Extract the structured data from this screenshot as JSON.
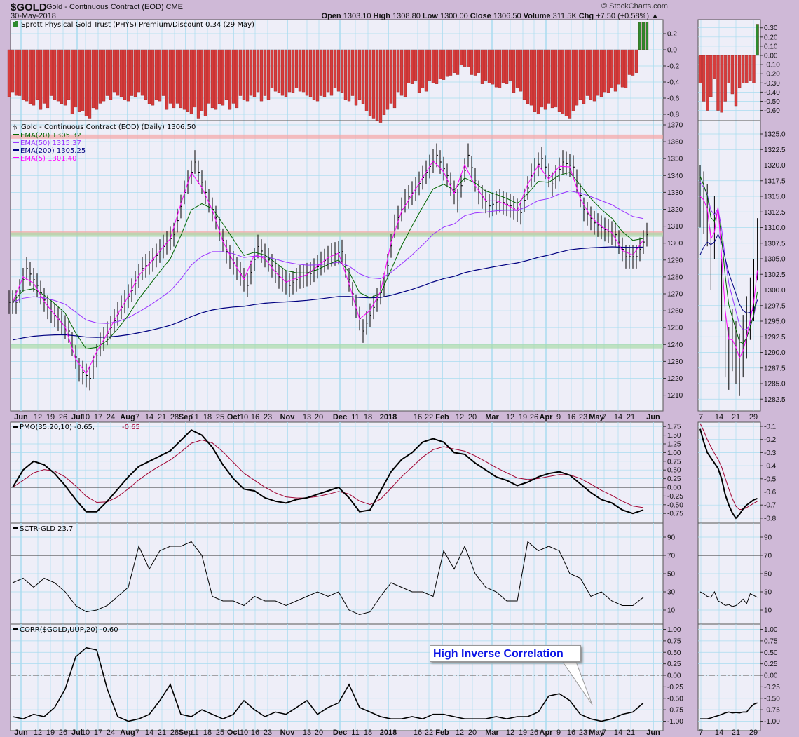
{
  "header": {
    "symbol": "$GOLD",
    "description": "Gold - Continuous Contract (EOD)",
    "exchange": "CME",
    "date": "30-May-2018",
    "copyright": "© StockCharts.com",
    "open_label": "Open",
    "open": "1303.10",
    "high_label": "High",
    "high": "1308.80",
    "low_label": "Low",
    "low": "1300.00",
    "close_label": "Close",
    "close": "1306.50",
    "volume_label": "Volume",
    "volume": "311.5K",
    "chg_label": "Chg",
    "chg": "+7.50 (+0.58%)"
  },
  "legends": {
    "phys": "Sprott Physical Gold Trust (PHYS) Premium/Discount 0.34 (29 May)",
    "price": "Gold - Continuous Contract (EOD) (Daily) 1306.50",
    "ema20": "EMA(20) 1305.32",
    "ema50": "EMA(50) 1315.37",
    "ema200": "EMA(200) 1305.25",
    "ema5": "EMA(5) 1301.40",
    "pmo": "PMO(35,20,10) -0.65,",
    "pmo_signal": "-0.65",
    "sctr": "SCTR-GLD 23.7",
    "corr": "CORR($GOLD,UUP,20) -0.60"
  },
  "annotation": "High Inverse Correlation",
  "colors": {
    "ema20": "#006600",
    "ema50": "#9933ff",
    "ema200": "#000080",
    "ema5": "#ff00ff",
    "pmo_signal": "#a00030",
    "bar_neg": "#d63c3c",
    "bar_pos": "#2e8b2e",
    "grid": "#a9dcef",
    "plot_bg": "#eeeef8",
    "frame_bg": "#cfb9d7"
  },
  "x_axis": {
    "main": [
      "Jun",
      "12",
      "19",
      "26",
      "Jul",
      "10",
      "17",
      "24",
      "Aug",
      "7",
      "14",
      "21",
      "28",
      "Sep",
      "11",
      "18",
      "25",
      "Oct",
      "10",
      "16",
      "23",
      "Nov",
      "13",
      "20",
      "Dec",
      "11",
      "18",
      "2018",
      "16",
      "22",
      "Feb",
      "12",
      "20",
      "Mar",
      "12",
      "19",
      "26",
      "Apr",
      "9",
      "16",
      "23",
      "May",
      "7",
      "14",
      "21",
      "Jun"
    ],
    "mini": [
      "7",
      "14",
      "21",
      "29"
    ]
  },
  "chart_data": [
    {
      "id": "phys",
      "type": "bar",
      "title": "Sprott Physical Gold Trust (PHYS) Premium/Discount",
      "ylim": [
        -0.9,
        0.35
      ],
      "yticks": [
        "0.2",
        "0.0",
        "-0.2",
        "-0.4",
        "-0.6",
        "-0.8"
      ],
      "values": [
        -0.55,
        -0.6,
        -0.65,
        -0.7,
        -0.6,
        -0.65,
        -0.75,
        -0.8,
        -0.7,
        -0.6,
        -0.55,
        -0.6,
        -0.55,
        -0.65,
        -0.6,
        -0.7,
        -0.7,
        -0.75,
        -0.8,
        -0.7,
        -0.65,
        -0.7,
        -0.6,
        -0.55,
        -0.6,
        -0.5,
        -0.55,
        -0.5,
        -0.55,
        -0.6,
        -0.55,
        -0.5,
        -0.6,
        -0.65,
        -0.8,
        -0.85,
        -0.7,
        -0.55,
        -0.4,
        -0.5,
        -0.4,
        -0.35,
        -0.3,
        -0.2,
        -0.3,
        -0.4,
        -0.45,
        -0.4,
        -0.5,
        -0.65,
        -0.75,
        -0.7,
        -0.75,
        -0.8,
        -0.65,
        -0.6,
        -0.55,
        -0.5,
        -0.45,
        -0.3,
        0.34
      ],
      "mini_yticks": [
        "0.30",
        "0.20",
        "0.10",
        "0.00",
        "-0.10",
        "-0.20",
        "-0.30",
        "-0.40",
        "-0.50",
        "-0.60"
      ],
      "mini_values": [
        -0.3,
        -0.5,
        -0.6,
        -0.45,
        -0.25,
        -0.6,
        -0.62,
        -0.5,
        -0.3,
        -0.42,
        -0.55,
        -0.35,
        -0.3,
        -0.3,
        -0.28,
        -0.3,
        0.34
      ]
    },
    {
      "id": "price",
      "type": "ohlc",
      "title": "Gold - Continuous Contract (EOD) (Daily)",
      "ylim": [
        1205,
        1372
      ],
      "yticks": [
        "1370",
        "1360",
        "1350",
        "1340",
        "1330",
        "1320",
        "1310",
        "1300",
        "1290",
        "1280",
        "1270",
        "1260",
        "1250",
        "1240",
        "1230",
        "1220",
        "1210"
      ],
      "close": [
        1265,
        1285,
        1275,
        1262,
        1255,
        1248,
        1225,
        1220,
        1240,
        1250,
        1262,
        1272,
        1285,
        1290,
        1298,
        1305,
        1330,
        1348,
        1330,
        1315,
        1295,
        1285,
        1275,
        1298,
        1290,
        1280,
        1275,
        1280,
        1282,
        1288,
        1293,
        1295,
        1270,
        1248,
        1262,
        1275,
        1310,
        1325,
        1332,
        1342,
        1352,
        1340,
        1325,
        1352,
        1330,
        1322,
        1325,
        1322,
        1318,
        1340,
        1350,
        1335,
        1348,
        1345,
        1320,
        1312,
        1308,
        1305,
        1292,
        1292,
        1305
      ],
      "levels_red": [
        1363,
        1306
      ],
      "levels_green": [
        1305,
        1239
      ],
      "mini_yticks": [
        "1325.0",
        "1322.5",
        "1320.0",
        "1317.5",
        "1315.0",
        "1312.5",
        "1310.0",
        "1307.5",
        "1305.0",
        "1302.5",
        "1300.0",
        "1297.5",
        "1295.0",
        "1292.5",
        "1290.0",
        "1287.5",
        "1285.0",
        "1282.5"
      ],
      "mini_close": [
        1315,
        1314,
        1312,
        1305,
        1310,
        1316,
        1300,
        1291,
        1289,
        1292,
        1290,
        1288,
        1291,
        1294,
        1297,
        1300,
        1306.5
      ]
    },
    {
      "id": "pmo",
      "type": "line",
      "title": "PMO(35,20,10)",
      "ylim": [
        -0.9,
        1.85
      ],
      "yticks": [
        "1.75",
        "1.50",
        "1.25",
        "1.00",
        "0.75",
        "0.50",
        "0.25",
        "0.00",
        "-0.25",
        "-0.50",
        "-0.75"
      ],
      "values": [
        0.0,
        0.5,
        0.75,
        0.65,
        0.4,
        0.05,
        -0.35,
        -0.7,
        -0.7,
        -0.4,
        -0.05,
        0.3,
        0.6,
        0.75,
        0.9,
        1.05,
        1.35,
        1.65,
        1.5,
        1.15,
        0.65,
        0.25,
        -0.05,
        -0.1,
        -0.3,
        -0.4,
        -0.45,
        -0.35,
        -0.3,
        -0.2,
        -0.1,
        0.0,
        -0.3,
        -0.7,
        -0.65,
        -0.1,
        0.45,
        0.8,
        1.0,
        1.3,
        1.4,
        1.3,
        1.0,
        0.95,
        0.7,
        0.5,
        0.3,
        0.2,
        0.05,
        0.15,
        0.3,
        0.4,
        0.45,
        0.35,
        0.1,
        -0.15,
        -0.35,
        -0.45,
        -0.65,
        -0.75,
        -0.65
      ],
      "mini_yticks": [
        "-0.1",
        "-0.2",
        "-0.3",
        "-0.4",
        "-0.5",
        "-0.6",
        "-0.7",
        "-0.8"
      ],
      "mini_values": [
        -0.12,
        -0.22,
        -0.3,
        -0.34,
        -0.38,
        -0.42,
        -0.5,
        -0.62,
        -0.7,
        -0.76,
        -0.8,
        -0.77,
        -0.73,
        -0.7,
        -0.68,
        -0.66,
        -0.65
      ]
    },
    {
      "id": "sctr",
      "type": "line",
      "title": "SCTR-GLD",
      "ylim": [
        0,
        100
      ],
      "yticks": [
        "90",
        "70",
        "50",
        "30",
        "10"
      ],
      "values": [
        40,
        45,
        35,
        45,
        40,
        30,
        15,
        8,
        10,
        15,
        25,
        35,
        80,
        55,
        75,
        80,
        80,
        85,
        70,
        25,
        20,
        20,
        15,
        25,
        20,
        20,
        15,
        20,
        25,
        30,
        25,
        30,
        10,
        5,
        8,
        25,
        40,
        35,
        30,
        30,
        25,
        75,
        55,
        80,
        50,
        35,
        30,
        20,
        20,
        85,
        75,
        80,
        75,
        50,
        45,
        25,
        30,
        20,
        15,
        15,
        24
      ],
      "mini_values": [
        30,
        28,
        25,
        24,
        30,
        20,
        18,
        15,
        16,
        14,
        15,
        18,
        22,
        17,
        28,
        26,
        24
      ]
    },
    {
      "id": "corr",
      "type": "line",
      "title": "CORR($GOLD,UUP,20)",
      "ylim": [
        -1.05,
        1.05
      ],
      "yticks": [
        "1.00",
        "0.75",
        "0.50",
        "0.25",
        "0.00",
        "-0.25",
        "-0.50",
        "-0.75",
        "-1.00"
      ],
      "values": [
        -0.9,
        -0.95,
        -0.85,
        -0.9,
        -0.7,
        -0.3,
        0.4,
        0.6,
        0.55,
        -0.3,
        -0.9,
        -1.0,
        -0.95,
        -0.85,
        -0.55,
        -0.2,
        -0.85,
        -0.9,
        -0.75,
        -0.85,
        -0.95,
        -0.85,
        -0.55,
        -0.75,
        -0.9,
        -0.8,
        -0.85,
        -0.7,
        -0.55,
        -0.85,
        -0.7,
        -0.6,
        -0.2,
        -0.7,
        -0.8,
        -0.9,
        -0.95,
        -0.95,
        -0.9,
        -0.95,
        -0.85,
        -0.85,
        -0.9,
        -0.95,
        -0.95,
        -0.95,
        -0.9,
        -0.95,
        -0.9,
        -0.9,
        -0.8,
        -0.45,
        -0.4,
        -0.55,
        -0.85,
        -0.95,
        -1.0,
        -0.95,
        -0.85,
        -0.8,
        -0.6
      ],
      "mini_values": [
        -0.95,
        -0.95,
        -0.95,
        -0.93,
        -0.9,
        -0.88,
        -0.85,
        -0.82,
        -0.8,
        -0.82,
        -0.81,
        -0.82,
        -0.8,
        -0.8,
        -0.7,
        -0.63,
        -0.6
      ]
    }
  ]
}
